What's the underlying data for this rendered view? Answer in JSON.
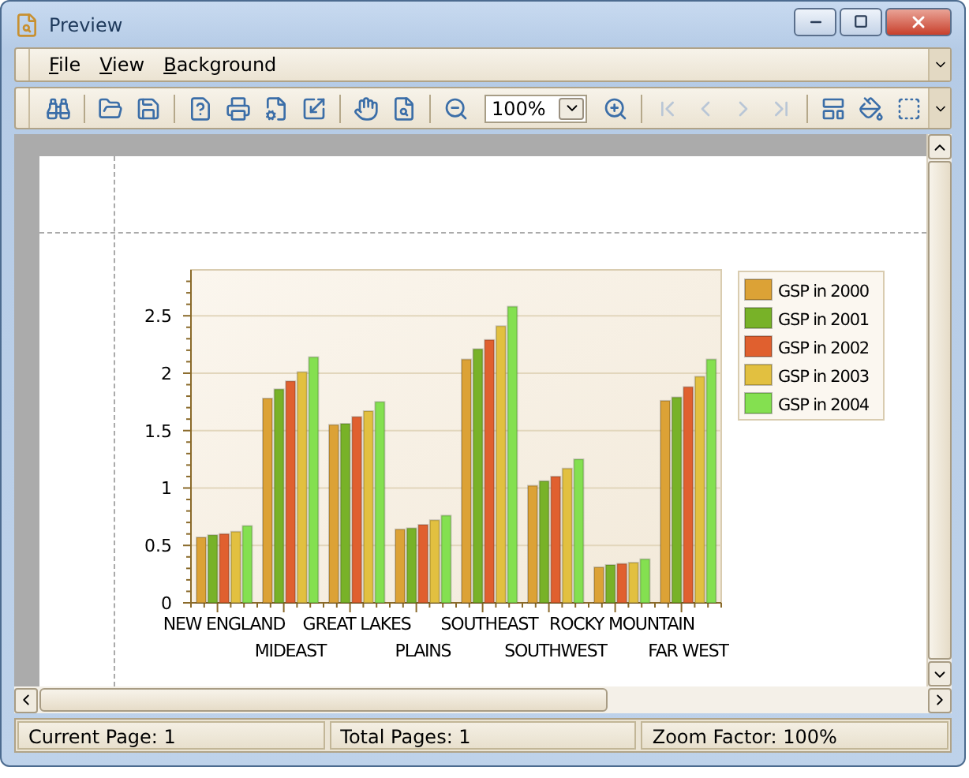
{
  "window": {
    "title": "Preview"
  },
  "menu": [
    {
      "label": "File"
    },
    {
      "label": "View"
    },
    {
      "label": "Background"
    }
  ],
  "toolbar": [
    {
      "kind": "button",
      "disabled": false
    },
    {
      "kind": "separator"
    },
    {
      "kind": "button",
      "disabled": false
    },
    {
      "kind": "button",
      "disabled": false
    },
    {
      "kind": "separator"
    },
    {
      "kind": "button",
      "disabled": false
    },
    {
      "kind": "button",
      "disabled": false
    },
    {
      "kind": "button",
      "disabled": false
    },
    {
      "kind": "button",
      "disabled": false
    },
    {
      "kind": "separator"
    },
    {
      "kind": "button",
      "disabled": false
    },
    {
      "kind": "button",
      "disabled": false
    },
    {
      "kind": "separator"
    },
    {
      "kind": "button",
      "disabled": false
    },
    {
      "kind": "combo",
      "value": "100%"
    },
    {
      "kind": "button",
      "disabled": false
    },
    {
      "kind": "separator"
    },
    {
      "kind": "button",
      "disabled": true
    },
    {
      "kind": "button",
      "disabled": true
    },
    {
      "kind": "button",
      "disabled": true
    },
    {
      "kind": "button",
      "disabled": true
    },
    {
      "kind": "separator"
    },
    {
      "kind": "button",
      "disabled": false
    },
    {
      "kind": "button",
      "disabled": false
    },
    {
      "kind": "button",
      "disabled": false
    }
  ],
  "chart": {
    "chart_data": {
      "type": "bar",
      "grid": true,
      "legend": true,
      "categories": [
        "NEW ENGLAND",
        "MIDEAST",
        "GREAT LAKES",
        "PLAINS",
        "SOUTHEAST",
        "SOUTHWEST",
        "ROCKY MOUNTAIN",
        "FAR WEST"
      ],
      "ylim": [
        0,
        2.9
      ],
      "yticks": [
        {
          "value": 0,
          "label": "0"
        },
        {
          "value": 0.5,
          "label": "0.5"
        },
        {
          "value": 1,
          "label": "1"
        },
        {
          "value": 1.5,
          "label": "1.5"
        },
        {
          "value": 2,
          "label": "2"
        },
        {
          "value": 2.5,
          "label": "2.5"
        }
      ],
      "series": [
        {
          "name": "GSP in 2000",
          "color": "#dca236",
          "values": [
            0.57,
            1.78,
            1.55,
            0.64,
            2.12,
            1.02,
            0.31,
            1.76
          ]
        },
        {
          "name": "GSP in 2001",
          "color": "#78b228",
          "values": [
            0.59,
            1.86,
            1.56,
            0.65,
            2.21,
            1.06,
            0.33,
            1.79
          ]
        },
        {
          "name": "GSP in 2002",
          "color": "#e0602f",
          "values": [
            0.6,
            1.93,
            1.62,
            0.68,
            2.29,
            1.1,
            0.34,
            1.88
          ]
        },
        {
          "name": "GSP in 2003",
          "color": "#e2c040",
          "values": [
            0.62,
            2.01,
            1.67,
            0.72,
            2.41,
            1.17,
            0.35,
            1.97
          ]
        },
        {
          "name": "GSP in 2004",
          "color": "#84e050",
          "values": [
            0.67,
            2.14,
            1.75,
            0.76,
            2.58,
            1.25,
            0.38,
            2.12
          ]
        }
      ]
    }
  },
  "status_bar": [
    "Current Page: 1",
    "Total Pages: 1",
    "Zoom Factor: 100%"
  ]
}
